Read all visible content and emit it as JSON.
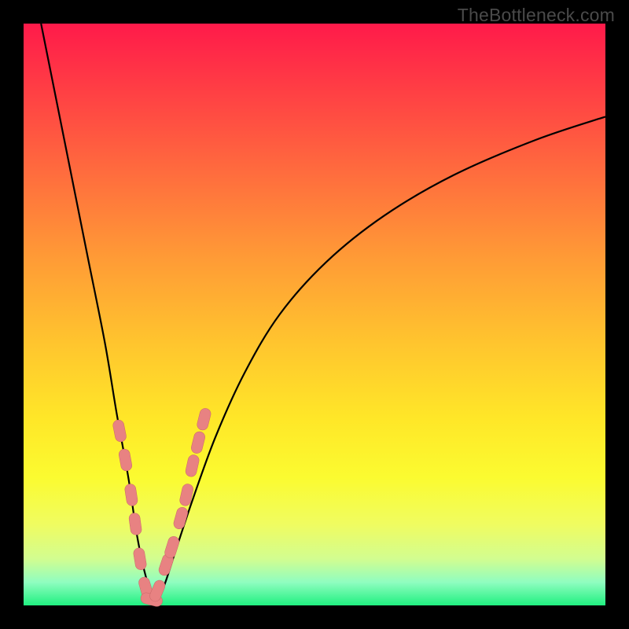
{
  "watermark": "TheBottleneck.com",
  "chart_data": {
    "type": "line",
    "title": "",
    "xlabel": "",
    "ylabel": "",
    "xlim": [
      0,
      100
    ],
    "ylim": [
      0,
      100
    ],
    "grid": false,
    "background_gradient": {
      "top": "#ff1a4a",
      "bottom": "#20f080",
      "meaning": "red at top (high bottleneck), green at bottom (low bottleneck)"
    },
    "series": [
      {
        "name": "bottleneck-curve",
        "color": "#000000",
        "x": [
          3,
          5,
          8,
          11,
          14,
          16,
          18,
          19.5,
          21,
          22.5,
          24,
          26,
          29,
          33,
          38,
          44,
          52,
          62,
          74,
          88,
          100
        ],
        "values": [
          100,
          90,
          75,
          60,
          45,
          33,
          22,
          12,
          5,
          1,
          3,
          9,
          18,
          29,
          40,
          50,
          59,
          67,
          74,
          80,
          84
        ]
      }
    ],
    "markers": {
      "name": "highlighted-points",
      "color": "#e88282",
      "shape": "pill",
      "x": [
        16.5,
        17.5,
        18.5,
        19.2,
        20,
        21,
        22,
        23,
        24.5,
        25.5,
        27,
        28,
        29,
        30,
        31
      ],
      "values": [
        30,
        25,
        19,
        14,
        8,
        3,
        1,
        2.5,
        7,
        10,
        15,
        19,
        24,
        28,
        32
      ]
    }
  }
}
